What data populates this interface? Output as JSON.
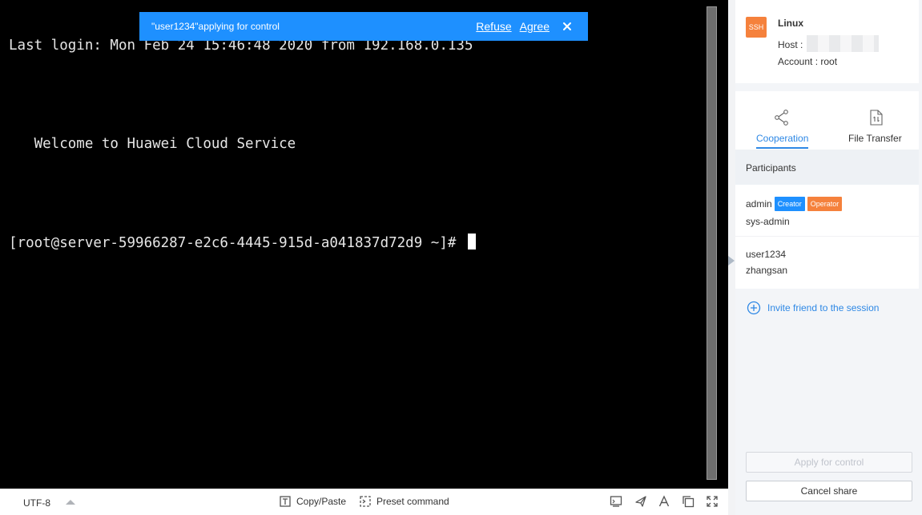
{
  "terminal": {
    "lines": [
      "Last login: Mon Feb 24 15:46:48 2020 from 192.168.0.135",
      "   Welcome to Huawei Cloud Service",
      "[root@server-59966287-e2c6-4445-915d-a041837d72d9 ~]# "
    ]
  },
  "notification": {
    "message": "\"user1234\"applying for control",
    "refuse_label": "Refuse",
    "agree_label": "Agree",
    "close_icon": "close-icon"
  },
  "toolbar": {
    "encoding": "UTF-8",
    "copy_paste_label": "Copy/Paste",
    "preset_command_label": "Preset command",
    "right_icons": [
      "monitor-icon",
      "send-icon",
      "font-icon",
      "window-icon",
      "fullscreen-icon"
    ]
  },
  "session": {
    "protocol": "SSH",
    "os": "Linux",
    "host_label": "Host :",
    "account_label": "Account : root"
  },
  "tabs": [
    {
      "label": "Cooperation",
      "icon": "share-icon",
      "active": true
    },
    {
      "label": "File Transfer",
      "icon": "file-transfer-icon",
      "active": false
    }
  ],
  "participants": {
    "title": "Participants",
    "items": [
      {
        "username": "admin",
        "role": "sys-admin",
        "tags": [
          "Creator",
          "Operator"
        ]
      },
      {
        "username": "user1234",
        "role": "zhangsan",
        "tags": []
      }
    ],
    "invite_label": "Invite friend to the session"
  },
  "actions": {
    "apply_control_label": "Apply for control",
    "cancel_share_label": "Cancel share"
  },
  "colors": {
    "accent": "#2e88e5",
    "banner": "#1e90ff",
    "ssh_badge": "#f5813c",
    "creator_tag": "#1e90ff",
    "operator_tag": "#f5813c"
  }
}
